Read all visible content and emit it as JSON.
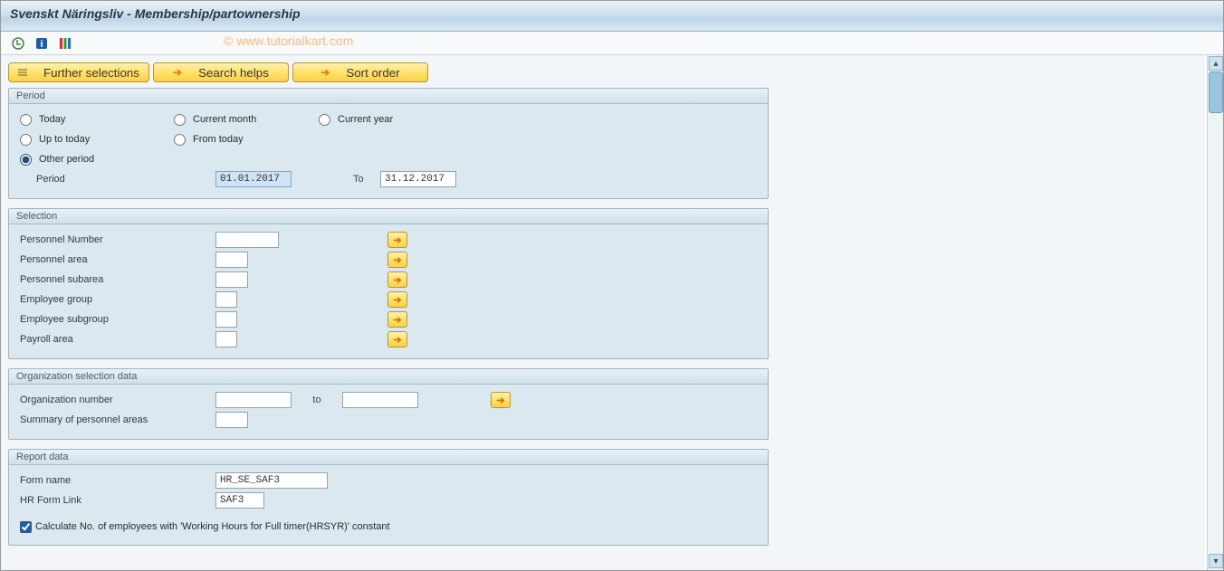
{
  "title": "Svenskt Näringsliv - Membership/partownership",
  "watermark": "© www.tutorialkart.com",
  "toolbar_buttons": {
    "further_selections": "Further selections",
    "search_helps": "Search helps",
    "sort_order": "Sort order"
  },
  "period": {
    "group_title": "Period",
    "options": {
      "today": "Today",
      "current_month": "Current month",
      "current_year": "Current year",
      "up_to_today": "Up to today",
      "from_today": "From today",
      "other_period": "Other period"
    },
    "selected": "other_period",
    "period_label": "Period",
    "from_value": "01.01.2017",
    "to_label": "To",
    "to_value": "31.12.2017"
  },
  "selection": {
    "group_title": "Selection",
    "fields": {
      "personnel_number": {
        "label": "Personnel Number",
        "value": ""
      },
      "personnel_area": {
        "label": "Personnel area",
        "value": ""
      },
      "personnel_subarea": {
        "label": "Personnel subarea",
        "value": ""
      },
      "employee_group": {
        "label": "Employee group",
        "value": ""
      },
      "employee_subgroup": {
        "label": "Employee subgroup",
        "value": ""
      },
      "payroll_area": {
        "label": "Payroll area",
        "value": ""
      }
    }
  },
  "org": {
    "group_title": "Organization selection data",
    "org_number_label": "Organization number",
    "org_number_from": "",
    "org_to_label": "to",
    "org_number_to": "",
    "summary_label": "Summary of personnel areas",
    "summary_value": ""
  },
  "report": {
    "group_title": "Report data",
    "form_name_label": "Form name",
    "form_name_value": "HR_SE_SAF3",
    "hr_form_link_label": "HR Form Link",
    "hr_form_link_value": "SAF3",
    "calc_check_label": "Calculate No. of employees with 'Working Hours for Full timer(HRSYR)' constant",
    "calc_checked": true
  },
  "icons": {
    "arrow": "➔",
    "up": "▴",
    "down": "▾"
  }
}
